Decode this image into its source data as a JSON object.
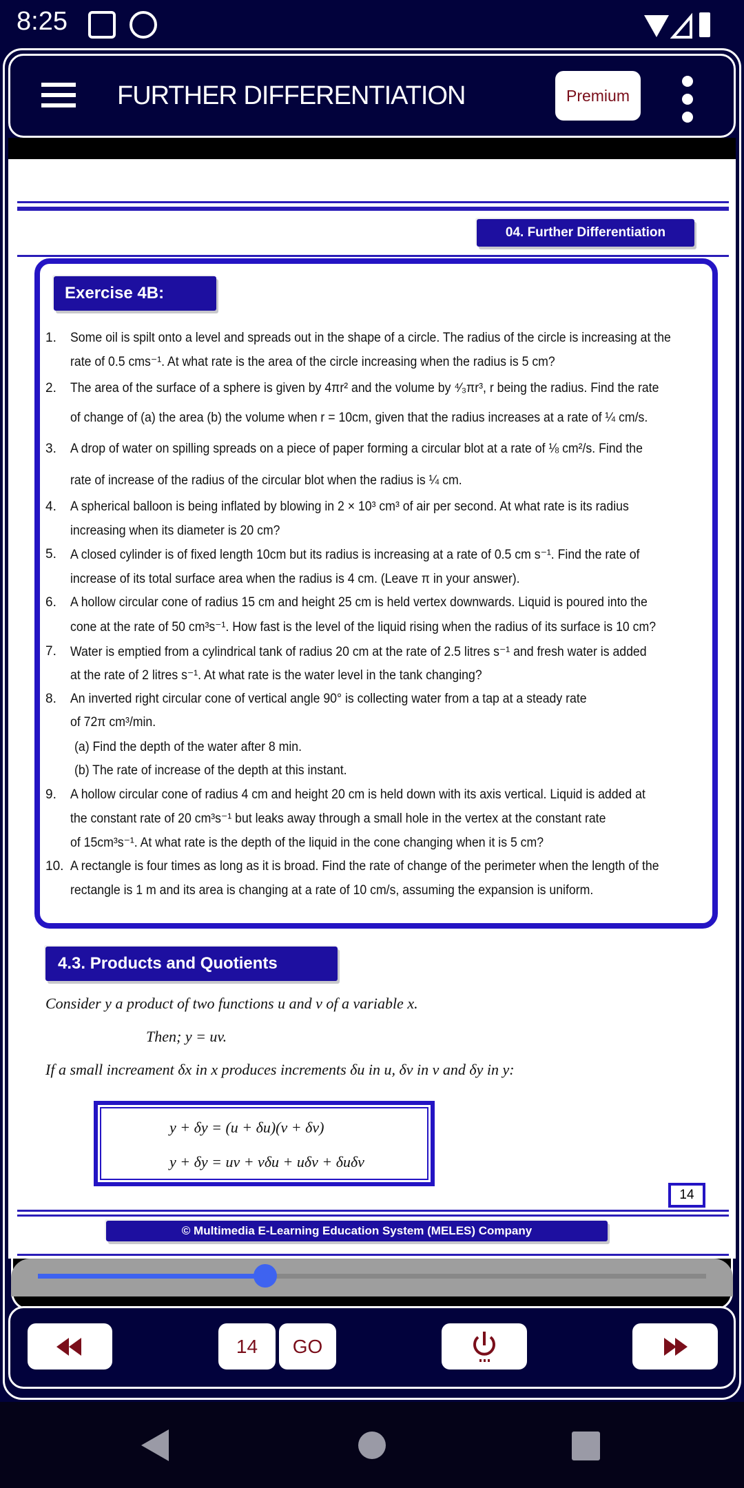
{
  "status": {
    "time": "8:25"
  },
  "header": {
    "title": "FURTHER DIFFERENTIATION",
    "premium": "Premium"
  },
  "page": {
    "chapter": "04. Further Differentiation",
    "exercise_title": "Exercise 4B:",
    "items": [
      {
        "num": "1.",
        "lines": [
          "Some oil is spilt onto a level and spreads out in the shape of a circle. The radius of the circle is increasing at the",
          "rate of 0.5 cms⁻¹. At what rate is the area of the circle increasing when the radius is 5 cm?"
        ]
      },
      {
        "num": "2.",
        "lines": [
          "The area of the surface of a sphere is given by  4πr² and the volume by ⁴⁄₃πr³, r being the radius. Find the rate",
          "of change of (a) the area (b) the volume when  r = 10cm, given that the radius increases at a rate of ¼ cm/s."
        ]
      },
      {
        "num": "3.",
        "lines": [
          "A drop of water on spilling spreads on a piece of paper forming a circular blot at a rate of ⅛ cm²/s. Find the",
          "rate of increase of the radius of the circular blot when the radius is ¼ cm."
        ]
      },
      {
        "num": "4.",
        "lines": [
          "A spherical balloon is being inflated by blowing in 2 × 10³ cm³ of air per second. At what rate is its radius",
          "increasing when its diameter is 20 cm?"
        ]
      },
      {
        "num": "5.",
        "lines": [
          "A closed cylinder is of fixed length 10cm but its radius is increasing at a rate of 0.5 cm s⁻¹. Find the rate of",
          "increase of its total surface area when the radius is 4 cm. (Leave π in your answer)."
        ]
      },
      {
        "num": "6.",
        "lines": [
          "A hollow circular cone of radius 15 cm and height 25 cm is held vertex downwards. Liquid is poured into the",
          "cone at the rate of 50 cm³s⁻¹. How fast is the level of the liquid rising when the radius of its surface is 10 cm?"
        ]
      },
      {
        "num": "7.",
        "lines": [
          "Water is emptied from a cylindrical tank of radius 20 cm at the rate of 2.5 litres s⁻¹ and fresh water is added",
          "at the rate of 2 litres s⁻¹. At what rate is the water level in the tank changing?"
        ]
      },
      {
        "num": "8.",
        "lines": [
          "An inverted right circular cone of vertical angle 90° is collecting water from a tap at a steady rate",
          "of  72π  cm³/min.",
          "(a)   Find the depth of the water after 8 min.",
          "(b)  The rate of increase of the depth at this instant."
        ]
      },
      {
        "num": "9.",
        "lines": [
          "A hollow circular cone of radius 4 cm and height 20 cm is held down with its axis vertical. Liquid is added at",
          "the constant rate of 20 cm³s⁻¹ but leaks away through a small hole in the vertex at the constant rate",
          "of 15cm³s⁻¹. At what rate is the depth of the liquid in the cone changing when it is 5 cm?"
        ]
      },
      {
        "num": "10.",
        "lines": [
          "A rectangle is four times as long as it is broad. Find the rate of change of the perimeter when the length of the",
          "rectangle is 1 m and its area is changing at a rate of 10 cm/s, assuming the expansion is uniform."
        ]
      }
    ],
    "section_title": "4.3. Products and Quotients",
    "para1": "Consider y a product of two functions u and v of a variable x.",
    "para2": "Then;  y = uv.",
    "para3": "If a small increament δx in x produces increments δu  in  u, δv  in v and  δy  in  y:",
    "formula1": "y + δy = (u + δu)(v + δv)",
    "formula2": "y + δy = uv + vδu + uδv + δuδv",
    "page_number": "14",
    "copyright": "© Multimedia E-Learning Education System (MELES) Company"
  },
  "slider": {
    "progress": 0.34
  },
  "bottom": {
    "page_input": "14",
    "go": "GO"
  },
  "colors": {
    "navy": "#02023c",
    "accent": "#1d0fa0",
    "button_text": "#7a0e1a",
    "slider": "#3e63f0"
  }
}
